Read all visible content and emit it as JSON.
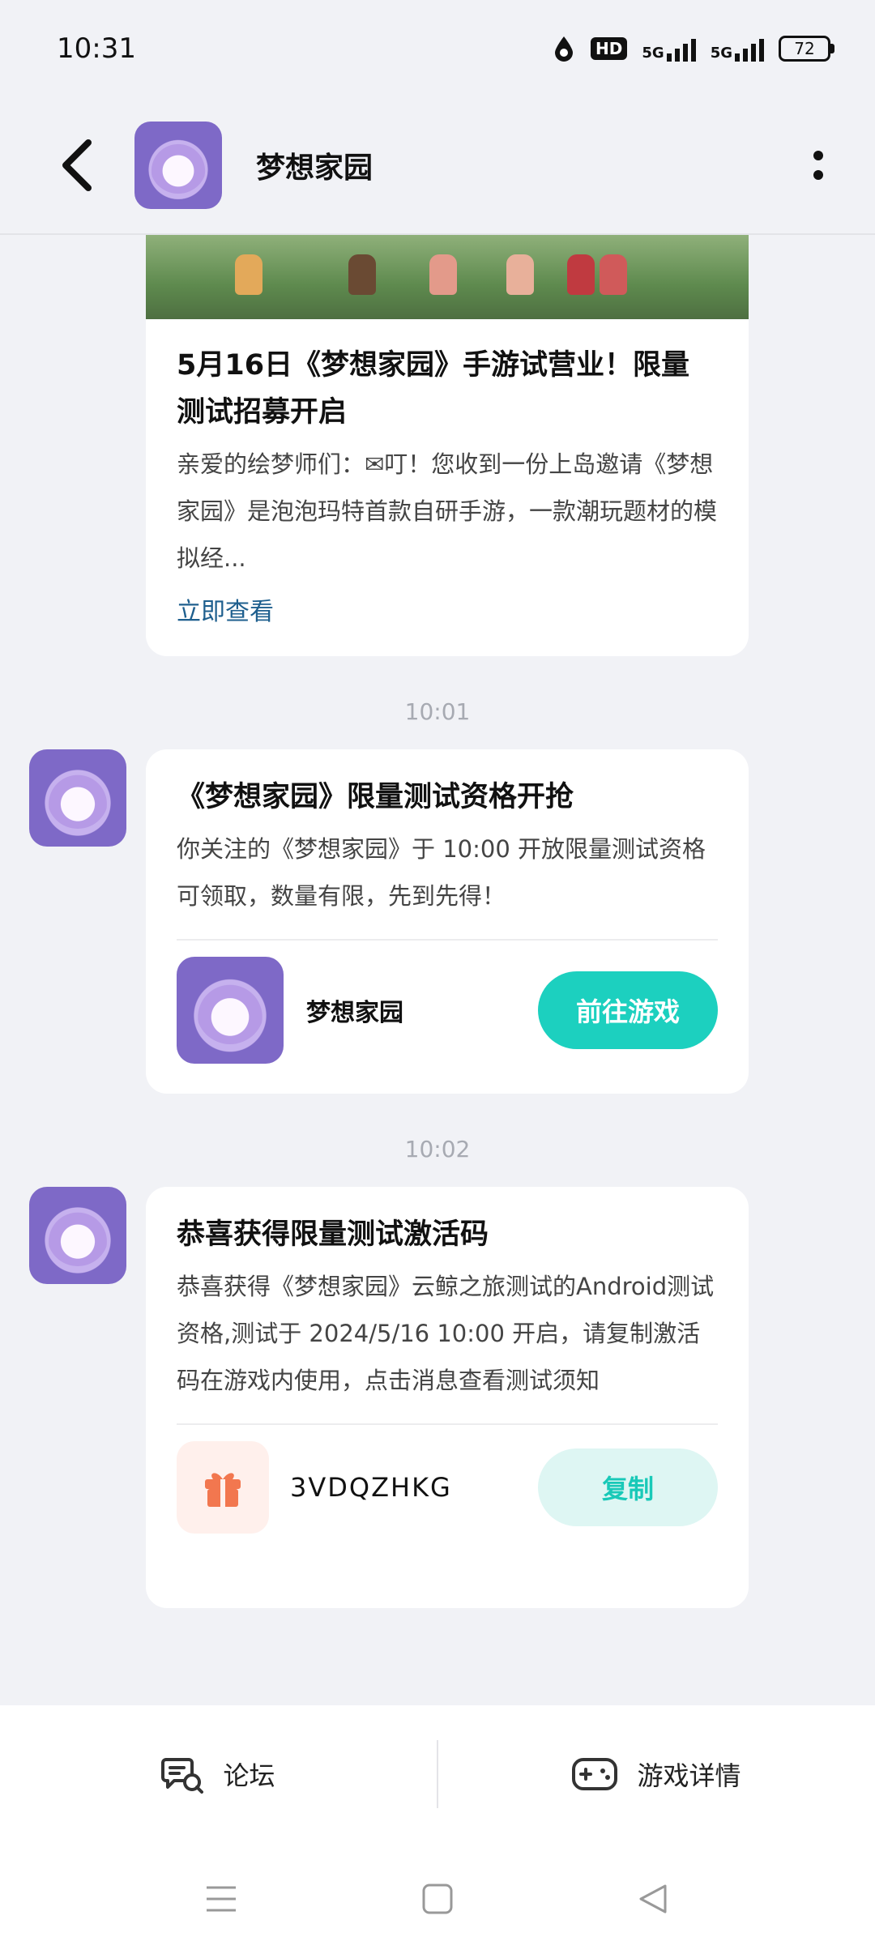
{
  "status_bar": {
    "time": "10:31",
    "hd_label": "HD",
    "signal1_label": "5G",
    "signal2_label": "5G",
    "battery": "72"
  },
  "header": {
    "title": "梦想家园"
  },
  "messages": [
    {
      "title": "5月16日《梦想家园》手游试营业！限量测试招募开启",
      "body": "亲爱的绘梦师们：✉叮！您收到一份上岛邀请《梦想家园》是泡泡玛特首款自研手游，一款潮玩题材的模拟经...",
      "link": "立即查看"
    },
    {
      "time": "10:01",
      "title": "《梦想家园》限量测试资格开抢",
      "body": "你关注的《梦想家园》于 10:00 开放限量测试资格可领取，数量有限，先到先得！",
      "game_name": "梦想家园",
      "button": "前往游戏"
    },
    {
      "time": "10:02",
      "title": "恭喜获得限量测试激活码",
      "body": "恭喜获得《梦想家园》云鲸之旅测试的Android测试资格,测试于 2024/5/16 10:00 开启，请复制激活码在游戏内使用，点击消息查看测试须知",
      "code": "3VDQZHKG",
      "button": "复制"
    }
  ],
  "bottom_tabs": [
    {
      "label": "论坛",
      "icon": "forum-icon"
    },
    {
      "label": "游戏详情",
      "icon": "gamepad-icon"
    }
  ],
  "colors": {
    "accent": "#1cd0bf",
    "link": "#1e5f8e",
    "gift": "#f2774f"
  }
}
